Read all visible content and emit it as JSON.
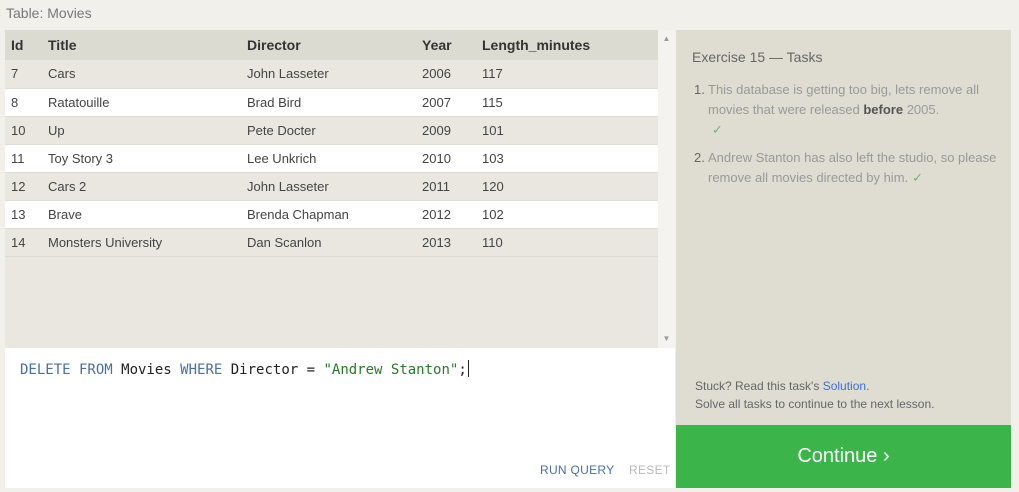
{
  "caption": "Table: Movies",
  "table": {
    "headers": [
      "Id",
      "Title",
      "Director",
      "Year",
      "Length_minutes"
    ],
    "rows": [
      [
        "7",
        "Cars",
        "John Lasseter",
        "2006",
        "117"
      ],
      [
        "8",
        "Ratatouille",
        "Brad Bird",
        "2007",
        "115"
      ],
      [
        "10",
        "Up",
        "Pete Docter",
        "2009",
        "101"
      ],
      [
        "11",
        "Toy Story 3",
        "Lee Unkrich",
        "2010",
        "103"
      ],
      [
        "12",
        "Cars 2",
        "John Lasseter",
        "2011",
        "120"
      ],
      [
        "13",
        "Brave",
        "Brenda Chapman",
        "2012",
        "102"
      ],
      [
        "14",
        "Monsters University",
        "Dan Scanlon",
        "2013",
        "110"
      ]
    ]
  },
  "editor": {
    "kw1": "DELETE FROM",
    "t1": " Movies ",
    "kw2": "WHERE",
    "t2": " Director = ",
    "str": "\"Andrew Stanton\"",
    "t3": ";",
    "run_label": "RUN QUERY",
    "reset_label": "RESET"
  },
  "exercise": {
    "title": "Exercise 15 — Tasks",
    "tasks": [
      {
        "num": "1.",
        "pre": "This database is getting too big, lets remove all movies that were released ",
        "bold": "before",
        "post": " 2005.",
        "check": "✓"
      },
      {
        "num": "2.",
        "text": "Andrew Stanton has also left the studio, so please remove all movies directed by him.",
        "check": "✓"
      }
    ],
    "stuck_prefix": "Stuck? Read this task's ",
    "solution_link": "Solution",
    "stuck_suffix": ".",
    "solve_text": "Solve all tasks to continue to the next lesson."
  },
  "continue_label": "Continue ›",
  "colors": {
    "continue_bg": "#3bb54a",
    "keyword": "#4a6fa5",
    "string": "#2a7a2a",
    "link": "#3d6fcf"
  }
}
